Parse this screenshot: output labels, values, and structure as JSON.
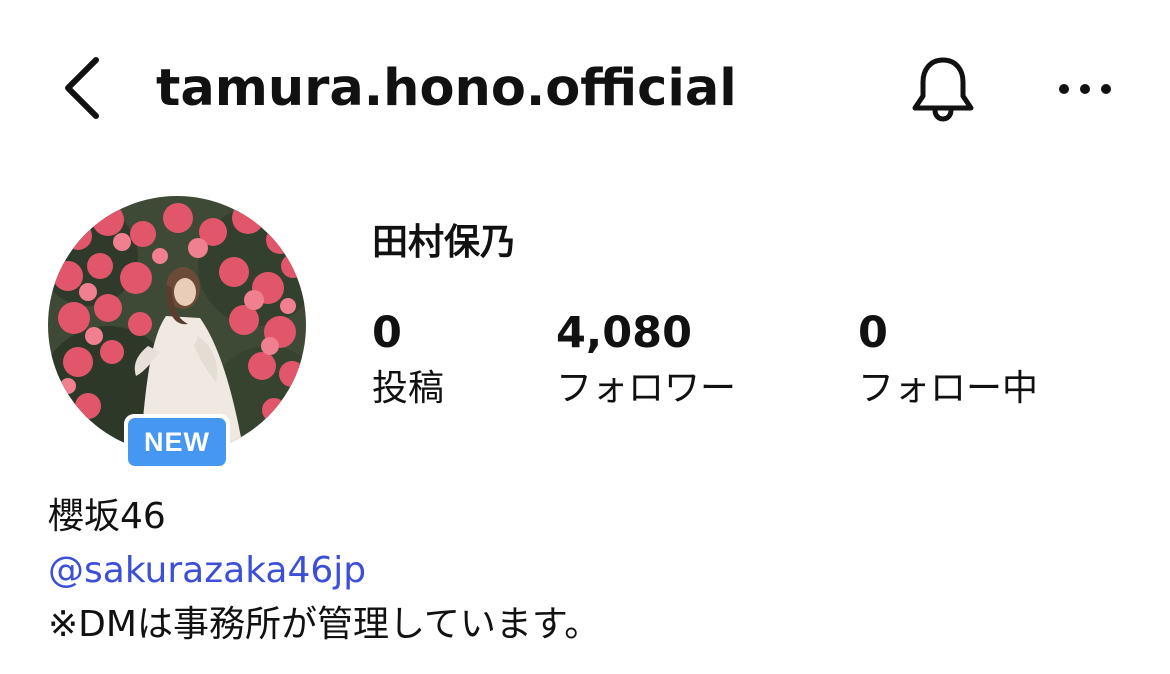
{
  "header": {
    "username": "tamura.hono.official",
    "back_icon": "chevron-left-icon",
    "notification_icon": "bell-icon",
    "more_icon": "ellipsis-icon"
  },
  "profile": {
    "avatar_icon": "profile-photo",
    "badge_label": "NEW",
    "badge_color": "#4597f1",
    "display_name": "田村保乃",
    "stats": [
      {
        "value": "0",
        "label": "投稿"
      },
      {
        "value": "4,080",
        "label": "フォロワー"
      },
      {
        "value": "0",
        "label": "フォロー中"
      }
    ]
  },
  "bio": {
    "group": "櫻坂46",
    "link": "@sakurazaka46jp",
    "link_color": "#3c4fd6",
    "note": "※DMは事務所が管理しています。"
  }
}
